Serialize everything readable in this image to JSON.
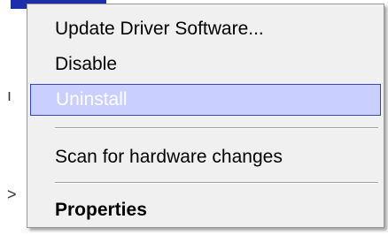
{
  "menu": {
    "items": [
      {
        "label": "Update Driver Software..."
      },
      {
        "label": "Disable"
      },
      {
        "label": "Uninstall",
        "state": "highlighted-disabled"
      },
      {
        "label": "Scan for hardware changes"
      },
      {
        "label": "Properties",
        "default": true
      }
    ]
  },
  "colors": {
    "menu_background": "#f0f0f0",
    "highlight_background": "#c9cfff",
    "highlight_border": "#3b43c3",
    "separator": "#a0a0a0",
    "selected_title_strip": "#1a2fa8"
  }
}
